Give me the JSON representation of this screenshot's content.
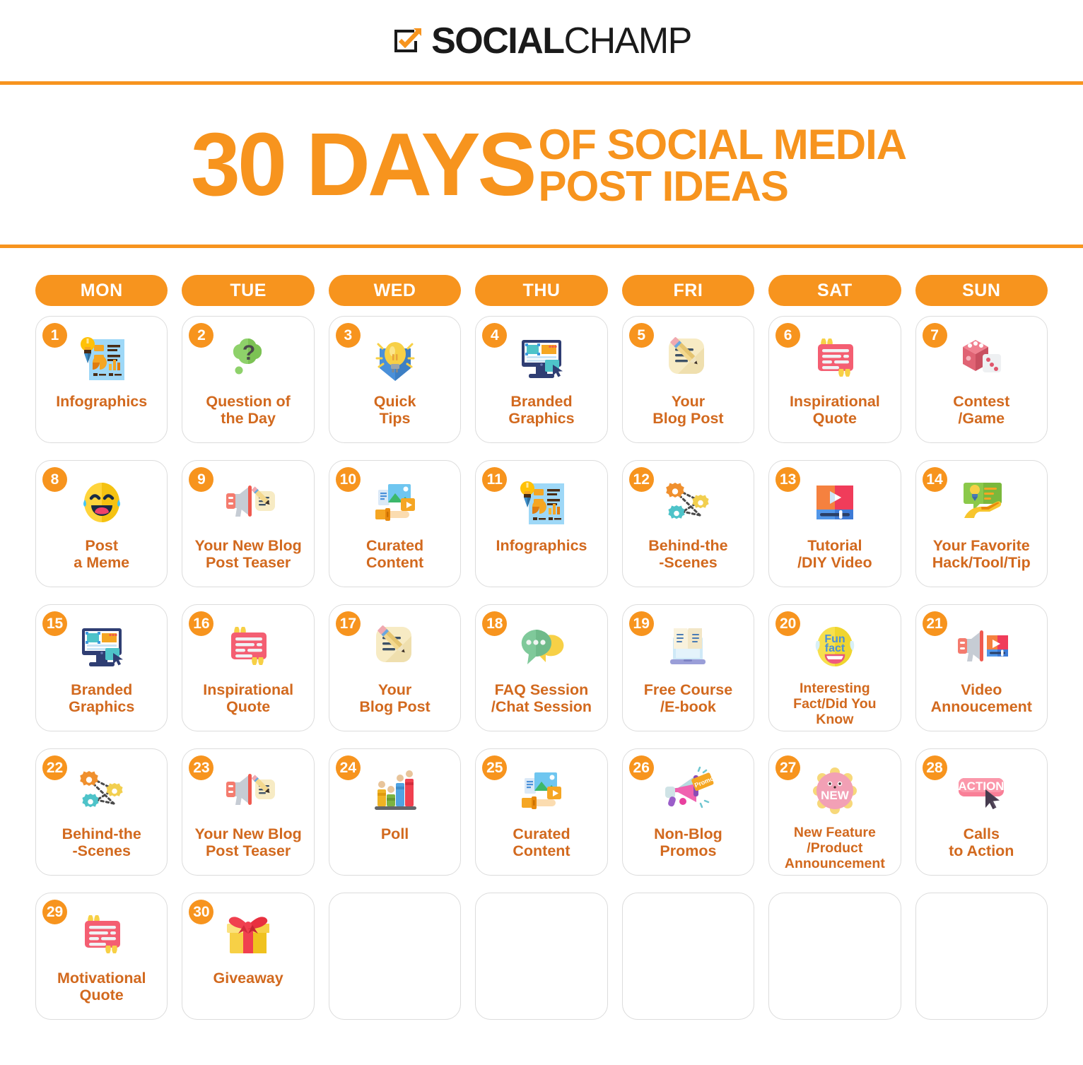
{
  "brand": {
    "logo_bold": "SOCIAL",
    "logo_light": "CHAMP",
    "logo_icon": "checkbox-check-icon",
    "accent_color": "#f7941e",
    "label_color": "#d2691e"
  },
  "title": {
    "big": "30 DAYS",
    "line1": "OF SOCIAL MEDIA",
    "line2": "POST IDEAS"
  },
  "calendar": {
    "day_headers": [
      "MON",
      "TUE",
      "WED",
      "THU",
      "FRI",
      "SAT",
      "SUN"
    ],
    "cells": [
      {
        "number": "1",
        "label": "Infographics",
        "icon": "infographic-report-icon"
      },
      {
        "number": "2",
        "label": "Question of\nthe Day",
        "icon": "question-thought-bubble-icon"
      },
      {
        "number": "3",
        "label": "Quick\nTips",
        "icon": "lightbulb-pin-icon"
      },
      {
        "number": "4",
        "label": "Branded\nGraphics",
        "icon": "desktop-design-icon"
      },
      {
        "number": "5",
        "label": "Your\nBlog Post",
        "icon": "notepad-pencil-icon"
      },
      {
        "number": "6",
        "label": "Inspirational\nQuote",
        "icon": "quote-card-icon"
      },
      {
        "number": "7",
        "label": "Contest\n/Game",
        "icon": "dice-icon"
      },
      {
        "number": "8",
        "label": "Post\na Meme",
        "icon": "laughing-tears-emoji-icon"
      },
      {
        "number": "9",
        "label": "Your New Blog\nPost Teaser",
        "icon": "megaphone-notepad-icon"
      },
      {
        "number": "10",
        "label": "Curated\nContent",
        "icon": "hand-media-content-icon"
      },
      {
        "number": "11",
        "label": "Infographics",
        "icon": "infographic-report-icon"
      },
      {
        "number": "12",
        "label": "Behind-the\n-Scenes",
        "icon": "gears-network-icon"
      },
      {
        "number": "13",
        "label": "Tutorial\n/DIY Video",
        "icon": "video-player-icon"
      },
      {
        "number": "14",
        "label": "Your Favorite\nHack/Tool/Tip",
        "icon": "hand-tip-bubble-icon"
      },
      {
        "number": "15",
        "label": "Branded\nGraphics",
        "icon": "desktop-design-icon"
      },
      {
        "number": "16",
        "label": "Inspirational\nQuote",
        "icon": "quote-card-icon"
      },
      {
        "number": "17",
        "label": "Your\nBlog Post",
        "icon": "notepad-pencil-icon"
      },
      {
        "number": "18",
        "label": "FAQ Session\n/Chat Session",
        "icon": "chat-bubbles-icon"
      },
      {
        "number": "19",
        "label": "Free Course\n/E-book",
        "icon": "ebook-laptop-icon"
      },
      {
        "number": "20",
        "label": "Interesting\nFact/Did You\nKnow",
        "icon": "fun-fact-emoji-icon"
      },
      {
        "number": "21",
        "label": "Video\nAnnoucement",
        "icon": "megaphone-video-icon"
      },
      {
        "number": "22",
        "label": "Behind-the\n-Scenes",
        "icon": "gears-network-icon"
      },
      {
        "number": "23",
        "label": "Your New Blog\nPost Teaser",
        "icon": "megaphone-notepad-icon"
      },
      {
        "number": "24",
        "label": "Poll",
        "icon": "poll-bar-people-icon"
      },
      {
        "number": "25",
        "label": "Curated\nContent",
        "icon": "hand-media-content-icon"
      },
      {
        "number": "26",
        "label": "Non-Blog\nPromos",
        "icon": "megaphone-promo-tag-icon"
      },
      {
        "number": "27",
        "label": "New Feature\n/Product\nAnnouncement",
        "icon": "new-badge-icon"
      },
      {
        "number": "28",
        "label": "Calls\nto Action",
        "icon": "action-button-cursor-icon"
      },
      {
        "number": "29",
        "label": "Motivational\nQuote",
        "icon": "quote-card-icon"
      },
      {
        "number": "30",
        "label": "Giveaway",
        "icon": "gift-box-icon"
      },
      {
        "number": "",
        "label": "",
        "icon": ""
      },
      {
        "number": "",
        "label": "",
        "icon": ""
      },
      {
        "number": "",
        "label": "",
        "icon": ""
      },
      {
        "number": "",
        "label": "",
        "icon": ""
      },
      {
        "number": "",
        "label": "",
        "icon": ""
      }
    ]
  }
}
